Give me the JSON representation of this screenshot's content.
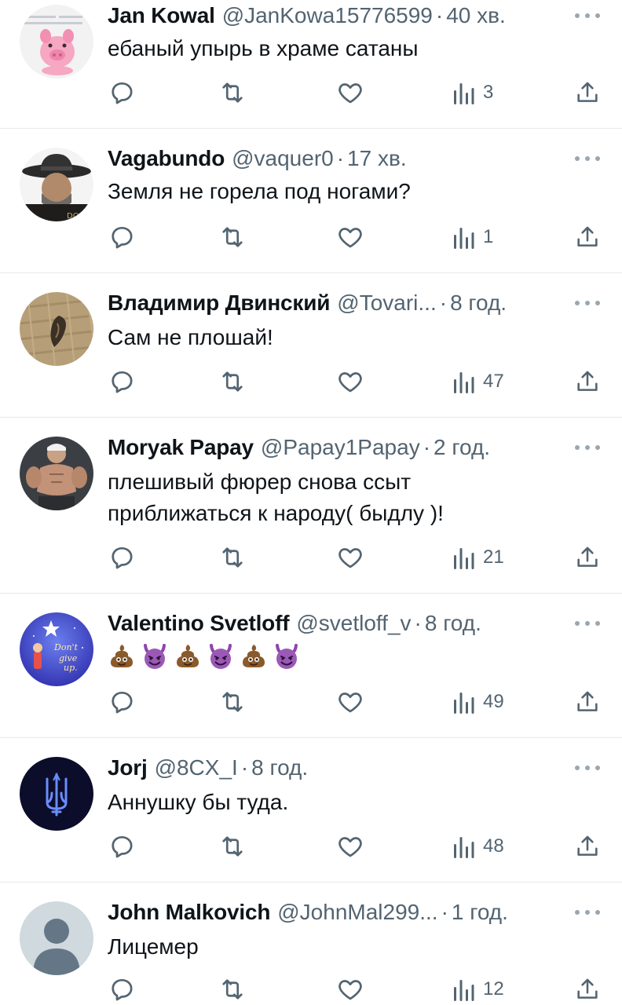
{
  "tweets": [
    {
      "name": "Jan Kowal",
      "handle": "@JanKowa15776599",
      "dot": "·",
      "time": "40 хв.",
      "text": "ебаный упырь в храме сатаны",
      "views": "3",
      "avatar": "pig-avatar"
    },
    {
      "name": "Vagabundo",
      "handle": "@vaquer0",
      "dot": "·",
      "time": "17 хв.",
      "text": "Земля не горела под ногами?",
      "views": "1",
      "avatar": "cowboy-avatar"
    },
    {
      "name": "Владимир Двинский",
      "handle": "@Tovari...",
      "dot": "·",
      "time": "8 год.",
      "text": "Сам не плошай!",
      "views": "47",
      "avatar": "pendant-avatar"
    },
    {
      "name": "Moryak Papay",
      "handle": "@Papay1Papay",
      "dot": "·",
      "time": "2 год.",
      "text_line1": "плешивый фюрер снова ссыт",
      "text_line2": "приближаться к народу( быдлу )!",
      "views": "21",
      "avatar": "popeye-avatar"
    },
    {
      "name": "Valentino Svetloff",
      "handle": "@svetloff_v",
      "dot": "·",
      "time": "8 год.",
      "emojis": [
        "poop-emoji",
        "devil-emoji",
        "poop-emoji",
        "devil-emoji",
        "poop-emoji",
        "devil-emoji"
      ],
      "views": "49",
      "avatar": "dont-give-up-avatar"
    },
    {
      "name": "Jorj",
      "handle": "@8CX_I",
      "dot": "·",
      "time": "8 год.",
      "text": "Аннушку бы туда.",
      "views": "48",
      "avatar": "trident-avatar"
    },
    {
      "name": "John Malkovich",
      "handle": "@JohnMal299...",
      "dot": "·",
      "time": "1 год.",
      "text": "Лицемер",
      "views": "12",
      "avatar": "default-avatar"
    }
  ],
  "avatar_texts": {
    "dont_give_up": "Don't give up."
  },
  "colors": {
    "text": "#0f1419",
    "secondary": "#536471",
    "divider": "#e7e9eb",
    "background": "#ffffff"
  }
}
